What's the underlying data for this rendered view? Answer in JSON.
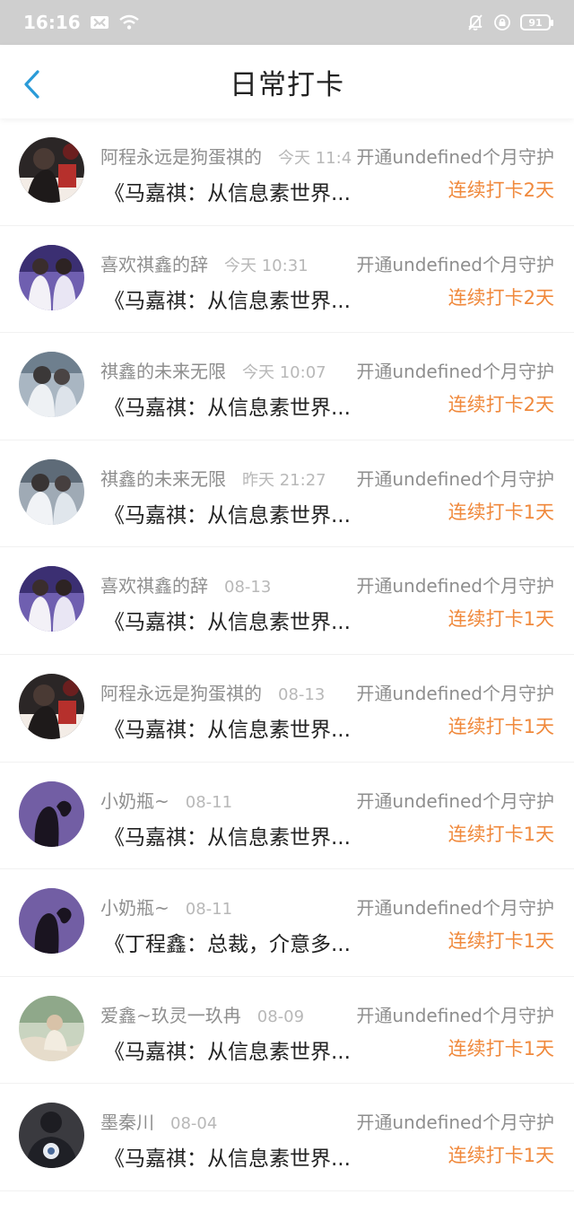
{
  "status_bar": {
    "time": "16:16",
    "battery": "91",
    "icons": [
      "mail-icon",
      "wifi-icon",
      "mute-bell-icon",
      "lock-rotation-icon",
      "battery-icon"
    ]
  },
  "nav": {
    "title": "日常打卡",
    "back_icon": "chevron-left-icon"
  },
  "colors": {
    "accent_blue": "#2a9bd8",
    "streak_orange": "#f0893c",
    "meta_gray": "#8e8e8e",
    "time_gray": "#b8b8b8"
  },
  "checkins": [
    {
      "user": "阿程永远是狗蛋祺的",
      "time": "今天 11:4",
      "guard": "开通undefined个月守护",
      "book": "《马嘉祺：从信息素世界...",
      "streak": "连续打卡2天"
    },
    {
      "user": "喜欢祺鑫的辞",
      "time": "今天 10:31",
      "guard": "开通undefined个月守护",
      "book": "《马嘉祺：从信息素世界...",
      "streak": "连续打卡2天"
    },
    {
      "user": "祺鑫的未来无限",
      "time": "今天 10:07",
      "guard": "开通undefined个月守护",
      "book": "《马嘉祺：从信息素世界...",
      "streak": "连续打卡2天"
    },
    {
      "user": "祺鑫的未来无限",
      "time": "昨天 21:27",
      "guard": "开通undefined个月守护",
      "book": "《马嘉祺：从信息素世界...",
      "streak": "连续打卡1天"
    },
    {
      "user": "喜欢祺鑫的辞",
      "time": "08-13",
      "guard": "开通undefined个月守护",
      "book": "《马嘉祺：从信息素世界...",
      "streak": "连续打卡1天"
    },
    {
      "user": "阿程永远是狗蛋祺的",
      "time": "08-13",
      "guard": "开通undefined个月守护",
      "book": "《马嘉祺：从信息素世界...",
      "streak": "连续打卡1天"
    },
    {
      "user": "小奶瓶~",
      "time": "08-11",
      "guard": "开通undefined个月守护",
      "book": "《马嘉祺：从信息素世界...",
      "streak": "连续打卡1天"
    },
    {
      "user": "小奶瓶~",
      "time": "08-11",
      "guard": "开通undefined个月守护",
      "book": "《丁程鑫：总裁，介意多...",
      "streak": "连续打卡1天"
    },
    {
      "user": "爱鑫~玖灵一玖冉",
      "time": "08-09",
      "guard": "开通undefined个月守护",
      "book": "《马嘉祺：从信息素世界...",
      "streak": "连续打卡1天"
    },
    {
      "user": "墨秦川",
      "time": "08-04",
      "guard": "开通undefined个月守护",
      "book": "《马嘉祺：从信息素世界...",
      "streak": "连续打卡1天"
    }
  ]
}
